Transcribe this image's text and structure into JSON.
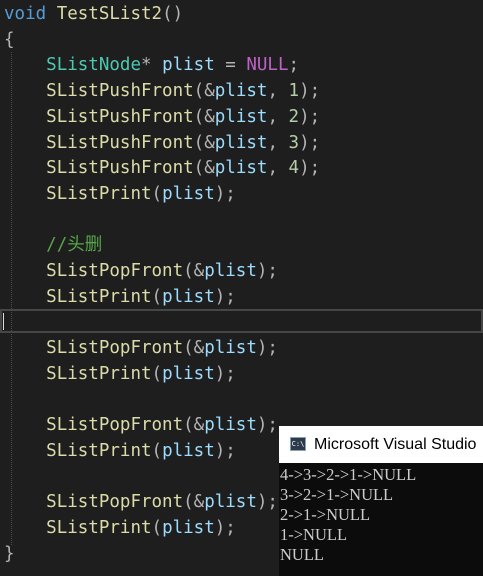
{
  "editor": {
    "lines": [
      {
        "id": "l01",
        "parts": [
          {
            "t": "void",
            "c": "kw"
          },
          {
            "t": " ",
            "c": "punc"
          },
          {
            "t": "TestSList2",
            "c": "fn"
          },
          {
            "t": "()",
            "c": "punc"
          }
        ]
      },
      {
        "id": "l02",
        "parts": [
          {
            "t": "{",
            "c": "punc"
          }
        ]
      },
      {
        "id": "l03",
        "parts": [
          {
            "t": "    ",
            "c": "punc"
          },
          {
            "t": "SListNode",
            "c": "ty"
          },
          {
            "t": "* ",
            "c": "punc"
          },
          {
            "t": "plist",
            "c": "var"
          },
          {
            "t": " = ",
            "c": "punc"
          },
          {
            "t": "NULL",
            "c": "mac"
          },
          {
            "t": ";",
            "c": "punc"
          }
        ]
      },
      {
        "id": "l04",
        "parts": [
          {
            "t": "    ",
            "c": "punc"
          },
          {
            "t": "SListPushFront",
            "c": "fn"
          },
          {
            "t": "(&",
            "c": "punc"
          },
          {
            "t": "plist",
            "c": "var"
          },
          {
            "t": ", ",
            "c": "punc"
          },
          {
            "t": "1",
            "c": "num"
          },
          {
            "t": ");",
            "c": "punc"
          }
        ]
      },
      {
        "id": "l05",
        "parts": [
          {
            "t": "    ",
            "c": "punc"
          },
          {
            "t": "SListPushFront",
            "c": "fn"
          },
          {
            "t": "(&",
            "c": "punc"
          },
          {
            "t": "plist",
            "c": "var"
          },
          {
            "t": ", ",
            "c": "punc"
          },
          {
            "t": "2",
            "c": "num"
          },
          {
            "t": ");",
            "c": "punc"
          }
        ]
      },
      {
        "id": "l06",
        "parts": [
          {
            "t": "    ",
            "c": "punc"
          },
          {
            "t": "SListPushFront",
            "c": "fn"
          },
          {
            "t": "(&",
            "c": "punc"
          },
          {
            "t": "plist",
            "c": "var"
          },
          {
            "t": ", ",
            "c": "punc"
          },
          {
            "t": "3",
            "c": "num"
          },
          {
            "t": ");",
            "c": "punc"
          }
        ]
      },
      {
        "id": "l07",
        "parts": [
          {
            "t": "    ",
            "c": "punc"
          },
          {
            "t": "SListPushFront",
            "c": "fn"
          },
          {
            "t": "(&",
            "c": "punc"
          },
          {
            "t": "plist",
            "c": "var"
          },
          {
            "t": ", ",
            "c": "punc"
          },
          {
            "t": "4",
            "c": "num"
          },
          {
            "t": ");",
            "c": "punc"
          }
        ]
      },
      {
        "id": "l08",
        "parts": [
          {
            "t": "    ",
            "c": "punc"
          },
          {
            "t": "SListPrint",
            "c": "fn"
          },
          {
            "t": "(",
            "c": "punc"
          },
          {
            "t": "plist",
            "c": "var"
          },
          {
            "t": ");",
            "c": "punc"
          }
        ]
      },
      {
        "id": "l09",
        "parts": []
      },
      {
        "id": "l10",
        "parts": [
          {
            "t": "    ",
            "c": "punc"
          },
          {
            "t": "//头删",
            "c": "cm"
          }
        ]
      },
      {
        "id": "l11",
        "parts": [
          {
            "t": "    ",
            "c": "punc"
          },
          {
            "t": "SListPopFront",
            "c": "fn"
          },
          {
            "t": "(&",
            "c": "punc"
          },
          {
            "t": "plist",
            "c": "var"
          },
          {
            "t": ");",
            "c": "punc"
          }
        ]
      },
      {
        "id": "l12",
        "parts": [
          {
            "t": "    ",
            "c": "punc"
          },
          {
            "t": "SListPrint",
            "c": "fn"
          },
          {
            "t": "(",
            "c": "punc"
          },
          {
            "t": "plist",
            "c": "var"
          },
          {
            "t": ");",
            "c": "punc"
          }
        ]
      },
      {
        "id": "l13",
        "parts": []
      },
      {
        "id": "l14",
        "parts": [
          {
            "t": "    ",
            "c": "punc"
          },
          {
            "t": "SListPopFront",
            "c": "fn"
          },
          {
            "t": "(&",
            "c": "punc"
          },
          {
            "t": "plist",
            "c": "var"
          },
          {
            "t": ");",
            "c": "punc"
          }
        ]
      },
      {
        "id": "l15",
        "parts": [
          {
            "t": "    ",
            "c": "punc"
          },
          {
            "t": "SListPrint",
            "c": "fn"
          },
          {
            "t": "(",
            "c": "punc"
          },
          {
            "t": "plist",
            "c": "var"
          },
          {
            "t": ");",
            "c": "punc"
          }
        ]
      },
      {
        "id": "l16",
        "parts": []
      },
      {
        "id": "l17",
        "parts": [
          {
            "t": "    ",
            "c": "punc"
          },
          {
            "t": "SListPopFront",
            "c": "fn"
          },
          {
            "t": "(&",
            "c": "punc"
          },
          {
            "t": "plist",
            "c": "var"
          },
          {
            "t": ");",
            "c": "punc"
          }
        ]
      },
      {
        "id": "l18",
        "parts": [
          {
            "t": "    ",
            "c": "punc"
          },
          {
            "t": "SListPrint",
            "c": "fn"
          },
          {
            "t": "(",
            "c": "punc"
          },
          {
            "t": "plist",
            "c": "var"
          },
          {
            "t": ");",
            "c": "punc"
          }
        ]
      },
      {
        "id": "l19",
        "parts": []
      },
      {
        "id": "l20",
        "parts": [
          {
            "t": "    ",
            "c": "punc"
          },
          {
            "t": "SListPopFront",
            "c": "fn"
          },
          {
            "t": "(&",
            "c": "punc"
          },
          {
            "t": "plist",
            "c": "var"
          },
          {
            "t": ");",
            "c": "punc"
          }
        ]
      },
      {
        "id": "l21",
        "parts": [
          {
            "t": "    ",
            "c": "punc"
          },
          {
            "t": "SListPrint",
            "c": "fn"
          },
          {
            "t": "(",
            "c": "punc"
          },
          {
            "t": "plist",
            "c": "var"
          },
          {
            "t": ");",
            "c": "punc"
          }
        ]
      },
      {
        "id": "l22",
        "parts": [
          {
            "t": "}",
            "c": "punc"
          }
        ]
      }
    ]
  },
  "console": {
    "icon": "console-app-icon",
    "icon_text": "C:\\",
    "title": "Microsoft Visual Studio",
    "output": [
      "4->3->2->1->NULL",
      "3->2->1->NULL",
      "2->1->NULL",
      "1->NULL",
      "NULL"
    ]
  },
  "colors": {
    "editor_bg": "#1e1e1e",
    "keyword": "#569cd6",
    "function": "#dcdcaa",
    "type": "#4ec9b0",
    "variable": "#9cdcfe",
    "macro": "#bd63c5",
    "number": "#b5cea8",
    "comment": "#57a64a",
    "console_bg": "#0c0c0c"
  }
}
